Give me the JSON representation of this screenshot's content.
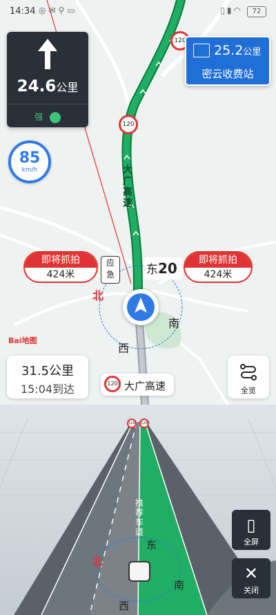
{
  "status_bar": {
    "time": "14:34",
    "battery": "72"
  },
  "turn_instruction": {
    "distance": "24.6",
    "unit": "公里",
    "signal_label": "强"
  },
  "toll_info": {
    "distance": "25.2",
    "unit": "公里",
    "name": "密云收费站"
  },
  "current_speed": {
    "value": "85",
    "unit": "km/h"
  },
  "road_labels": {
    "highway_name": "大广高速",
    "exit_number": "20"
  },
  "cameras": {
    "left": {
      "label": "即将抓拍",
      "distance": "424米"
    },
    "right": {
      "label": "即将抓拍",
      "distance": "424米"
    },
    "emergency_lane": "应急"
  },
  "compass": {
    "north": "北",
    "east": "东",
    "south": "南",
    "west": "西"
  },
  "speed_limits": [
    "120",
    "120",
    "120",
    "120",
    "120"
  ],
  "trip_summary": {
    "remaining_distance": "31.5公里",
    "arrival_time": "15:04到达"
  },
  "current_road": {
    "limit": "120",
    "name": "大广高速"
  },
  "overview_button": {
    "label": "全览"
  },
  "lane_view": {
    "lane_label": "推荐车道",
    "fullscreen_label": "全屏",
    "close_label": "关闭"
  },
  "brand": {
    "logo_text": "Bai地图"
  },
  "colors": {
    "route_green": "#1fae63",
    "camera_red": "#e03434",
    "accent_blue": "#2f7ae5",
    "card_dark": "#2a3038"
  }
}
